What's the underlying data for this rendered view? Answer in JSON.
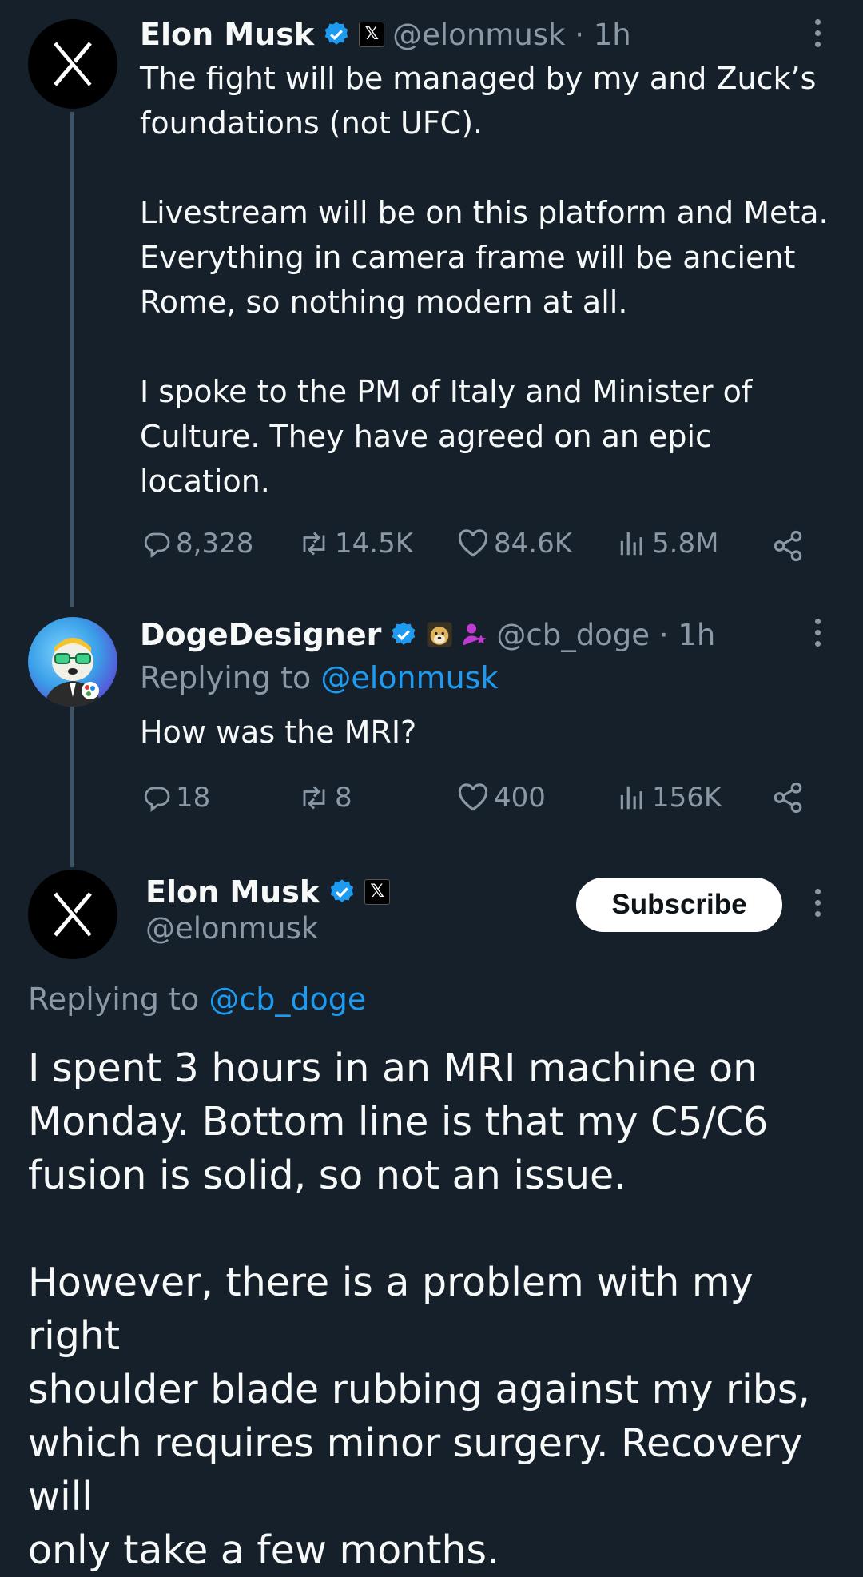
{
  "tweet1": {
    "name": "Elon Musk",
    "handle": "@elonmusk · 1h",
    "badge_letter": "𝕏",
    "body": "The fight will be managed by my and Zuck’s\nfoundations (not UFC).\n\nLivestream will be on this platform and Meta.\nEverything in camera frame will be ancient\nRome, so nothing modern at all.\n\nI spoke to the PM of Italy and Minister of\nCulture. They have agreed on an epic\nlocation.",
    "replies": "8,328",
    "reposts": "14.5K",
    "likes": "84.6K",
    "views": "5.8M"
  },
  "tweet2": {
    "name": "DogeDesigner",
    "handle": "@cb_doge · 1h",
    "replying_prefix": "Replying to ",
    "replying_to": "@elonmusk",
    "body": "How was the MRI?",
    "replies": "18",
    "reposts": "8",
    "likes": "400",
    "views": "156K"
  },
  "tweet3": {
    "name": "Elon Musk",
    "handle": "@elonmusk",
    "badge_letter": "𝕏",
    "subscribe_label": "Subscribe",
    "replying_prefix": "Replying to ",
    "replying_to": "@cb_doge",
    "body": "I spent 3 hours in an MRI machine on\nMonday. Bottom line is that my C5/C6\nfusion is solid, so not an issue.\n\nHowever, there is a problem with my right\nshoulder blade rubbing against my ribs,\nwhich requires minor surgery. Recovery will\nonly take a few months."
  },
  "icons": {
    "reply": "reply-icon",
    "repost": "repost-icon",
    "like": "heart-icon",
    "views": "views-icon",
    "share": "share-icon",
    "verified": "verified-badge-icon",
    "more": "more-icon"
  },
  "colors": {
    "background": "#15202b",
    "accent": "#1d9bf0",
    "muted": "#8b98a5",
    "text": "#f7f9f9"
  }
}
